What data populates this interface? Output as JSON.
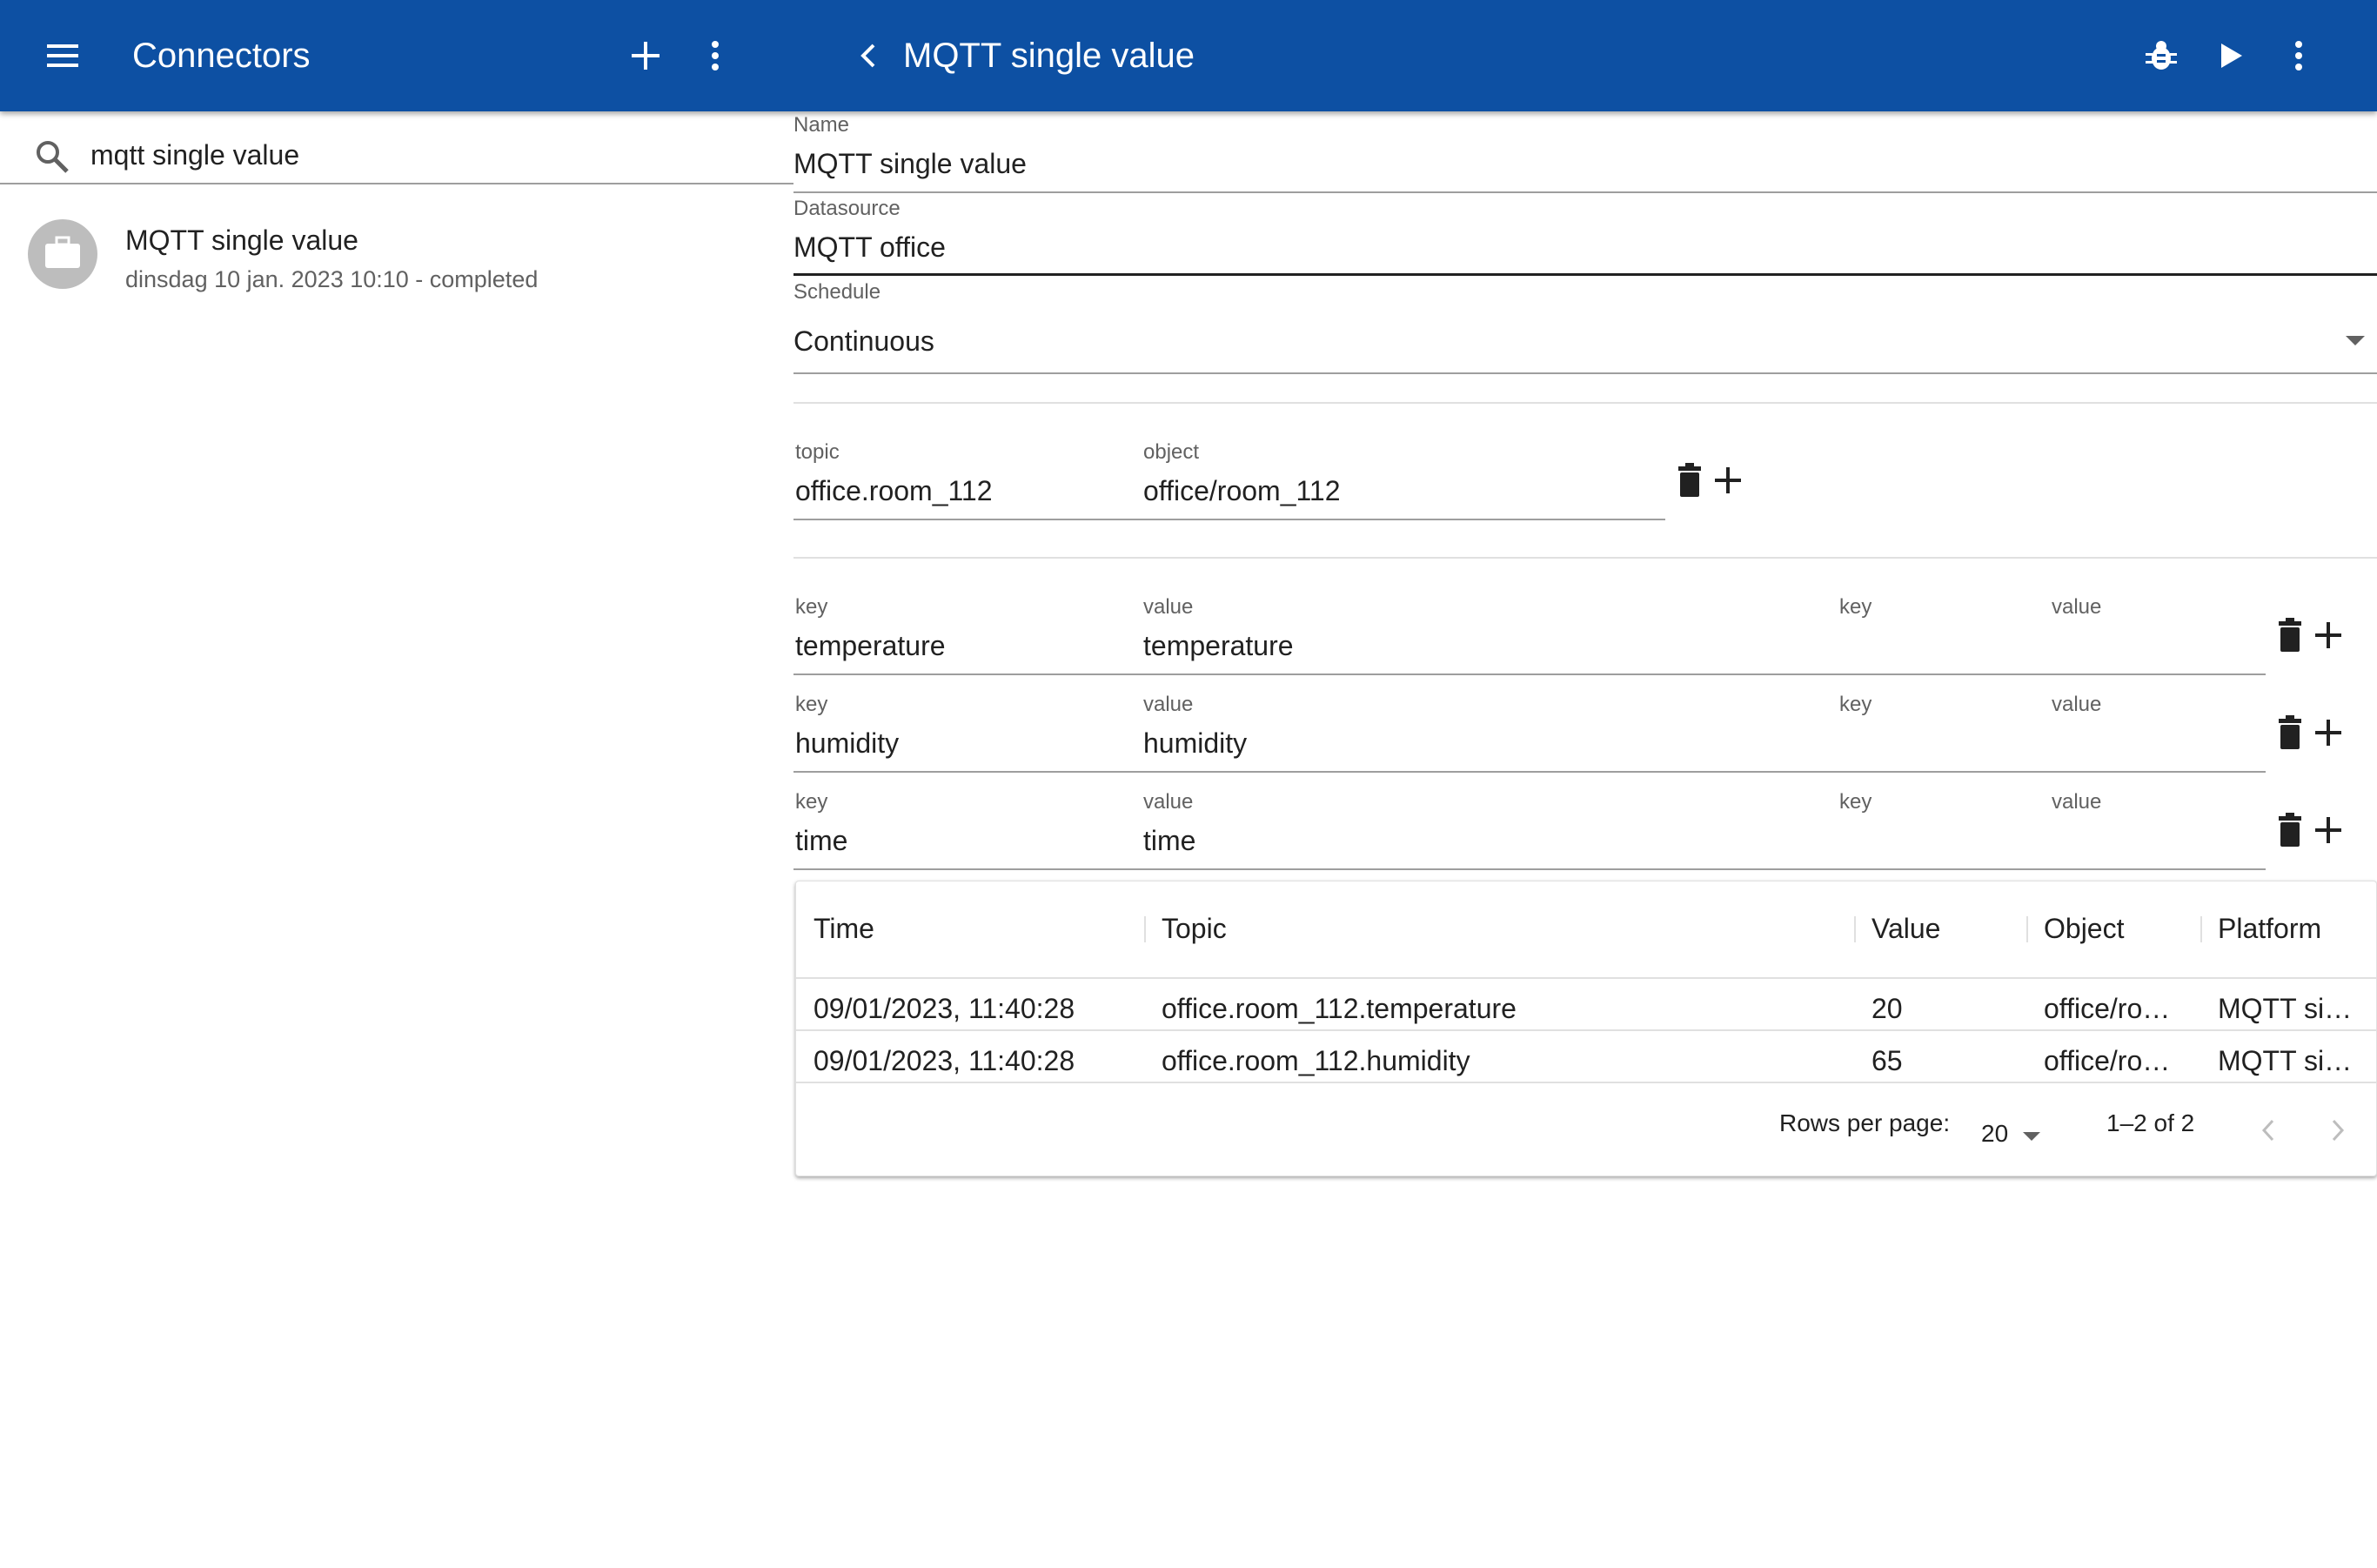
{
  "appbar": {
    "left_title": "Connectors",
    "right_title": "MQTT single value",
    "icons": [
      "menu-icon",
      "add-icon",
      "more-vert-icon",
      "back-chevron-icon",
      "bug-icon",
      "play-icon",
      "more-vert-icon"
    ],
    "color": "#0d50a3"
  },
  "search": {
    "value": "mqtt single value",
    "icon": "search-icon"
  },
  "connectors": [
    {
      "title": "MQTT single value",
      "subtitle": "dinsdag 10 jan. 2023 10:10 - completed",
      "icon": "briefcase-icon"
    }
  ],
  "form": {
    "name": {
      "label": "Name",
      "value": "MQTT single value"
    },
    "datasource": {
      "label": "Datasource",
      "value": "MQTT office"
    },
    "schedule": {
      "label": "Schedule",
      "value": "Continuous"
    },
    "topic_row": {
      "topic_label": "topic",
      "topic_value": "office.room_112",
      "object_label": "object",
      "object_value": "office/room_112"
    },
    "kv_rows": [
      {
        "key_label": "key",
        "key_value": "temperature",
        "value_label": "value",
        "value_value": "temperature",
        "key2_label": "key",
        "value2_label": "value"
      },
      {
        "key_label": "key",
        "key_value": "humidity",
        "value_label": "value",
        "value_value": "humidity",
        "key2_label": "key",
        "value2_label": "value"
      },
      {
        "key_label": "key",
        "key_value": "time",
        "value_label": "value",
        "value_value": "time",
        "key2_label": "key",
        "value2_label": "value"
      }
    ]
  },
  "table": {
    "columns": [
      "Time",
      "Topic",
      "Value",
      "Object",
      "Platform"
    ],
    "rows": [
      [
        "09/01/2023, 11:40:28",
        "office.room_112.temperature",
        "20",
        "office/ro…",
        "MQTT si…"
      ],
      [
        "09/01/2023, 11:40:28",
        "office.room_112.humidity",
        "65",
        "office/ro…",
        "MQTT si…"
      ]
    ],
    "rows_per_page_label": "Rows per page:",
    "rows_per_page_value": "20",
    "range_text": "1–2 of 2"
  }
}
